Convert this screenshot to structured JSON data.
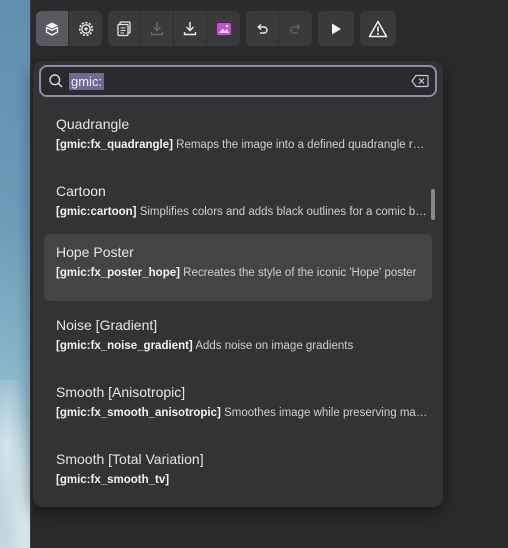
{
  "toolbar": {
    "groups": [
      [
        {
          "icon": "layer-cube-icon",
          "active": true
        },
        {
          "icon": "settings-gear-icon"
        }
      ],
      [
        {
          "icon": "clipboard-copy-icon"
        },
        {
          "icon": "download-disabled-icon",
          "disabled": true
        },
        {
          "icon": "download-icon"
        },
        {
          "icon": "image-icon"
        }
      ],
      [
        {
          "icon": "undo-icon"
        },
        {
          "icon": "redo-disabled-icon",
          "disabled": true
        }
      ],
      [
        {
          "icon": "play-icon"
        }
      ],
      [
        {
          "icon": "warning-icon"
        }
      ]
    ],
    "accent": "#c24fd6"
  },
  "search": {
    "value": "gmic:",
    "icon": "search-icon",
    "clear_icon": "clear-input-icon"
  },
  "results": [
    {
      "title": "Quadrangle",
      "cmd": "[gmic:fx_quadrangle]",
      "desc": "Remaps the image into a defined quadrangle region"
    },
    {
      "title": "Cartoon",
      "cmd": "[gmic:cartoon]",
      "desc": "Simplifies colors and adds black outlines for a comic boo..."
    },
    {
      "title": "Hope Poster",
      "cmd": "[gmic:fx_poster_hope]",
      "desc": "Recreates the style of the iconic 'Hope' poster",
      "highlighted": true
    },
    {
      "title": "Noise [Gradient]",
      "cmd": "[gmic:fx_noise_gradient]",
      "desc": "Adds noise on image gradients"
    },
    {
      "title": "Smooth [Anisotropic]",
      "cmd": "[gmic:fx_smooth_anisotropic]",
      "desc": "Smoothes image while preserving main ed..."
    },
    {
      "title": "Smooth [Total Variation]",
      "cmd": "[gmic:fx_smooth_tv]",
      "desc": ""
    }
  ],
  "colors": {
    "panel": "#333336",
    "highlight": "#444447",
    "search_border": "#8e8aa8",
    "selection": "#6e6a90"
  }
}
